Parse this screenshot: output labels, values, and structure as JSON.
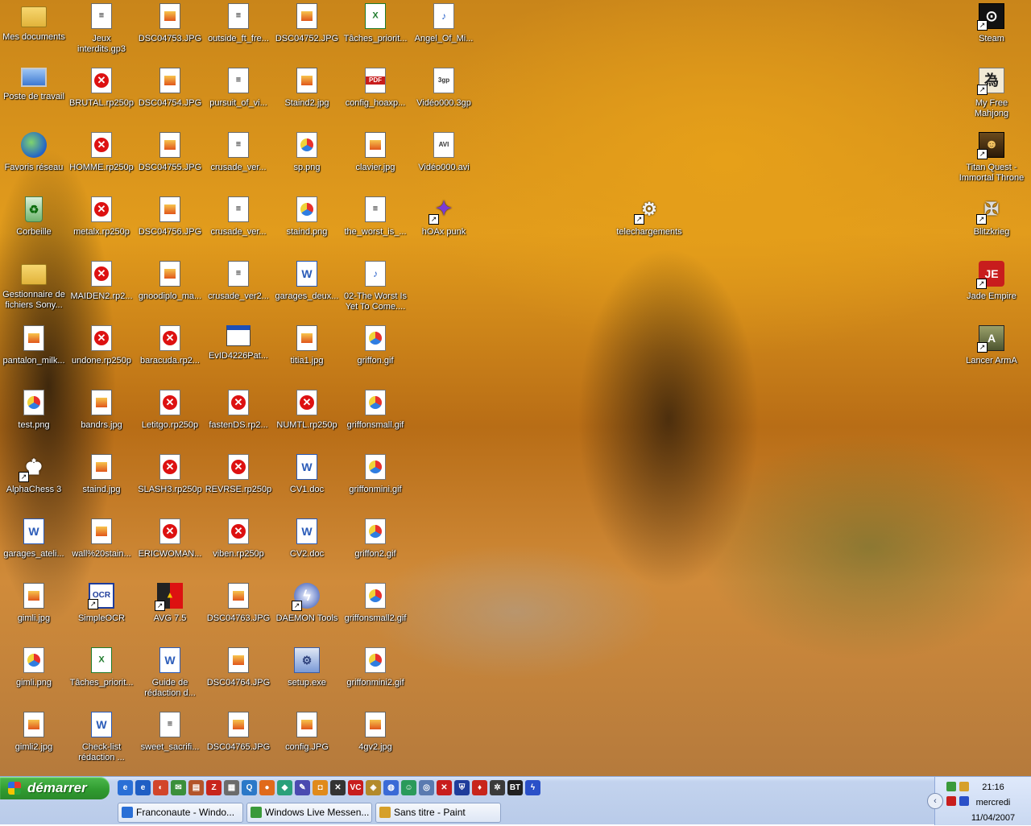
{
  "desktop": {
    "icons": [
      {
        "label": "Mes documents",
        "type": "folder",
        "sym": ""
      },
      {
        "label": "Jeux\ninterdits.gp3",
        "type": "doc",
        "sym": "≡"
      },
      {
        "label": "DSC04753.JPG",
        "type": "jpg",
        "sym": ""
      },
      {
        "label": "outside_ft_fre...",
        "type": "doc",
        "sym": "≡"
      },
      {
        "label": "DSC04752.JPG",
        "type": "jpg",
        "sym": ""
      },
      {
        "label": "Tâches_priorit...",
        "type": "xls",
        "sym": "X"
      },
      {
        "label": "Angel_Of_Mi...",
        "type": "mp3",
        "sym": "♪"
      },
      {
        "label": "Poste de travail",
        "type": "pc",
        "sym": ""
      },
      {
        "label": "BRUTAL.rp250p",
        "type": "rp",
        "sym": "✕"
      },
      {
        "label": "DSC04754.JPG",
        "type": "jpg",
        "sym": ""
      },
      {
        "label": "pursuit_of_vi...",
        "type": "doc",
        "sym": "≡"
      },
      {
        "label": "Staind2.jpg",
        "type": "jpg",
        "sym": ""
      },
      {
        "label": "config_hoaxp...",
        "type": "pdf",
        "sym": "PDF"
      },
      {
        "label": "Vidéo000.3gp",
        "type": "3gp",
        "sym": "3gp"
      },
      {
        "label": "Favoris réseau",
        "type": "net",
        "sym": ""
      },
      {
        "label": "HOMME.rp250p",
        "type": "rp",
        "sym": "✕"
      },
      {
        "label": "DSC04755.JPG",
        "type": "jpg",
        "sym": ""
      },
      {
        "label": "crusade_ver...",
        "type": "doc",
        "sym": "≡"
      },
      {
        "label": "sp.png",
        "type": "png",
        "sym": ""
      },
      {
        "label": "clavier.jpg",
        "type": "jpg",
        "sym": ""
      },
      {
        "label": "Vidéo000.avi",
        "type": "avi",
        "sym": "AVI"
      },
      {
        "label": "Corbeille",
        "type": "bin",
        "sym": "♻"
      },
      {
        "label": "metalx.rp250p",
        "type": "rp",
        "sym": "✕"
      },
      {
        "label": "DSC04756.JPG",
        "type": "jpg",
        "sym": ""
      },
      {
        "label": "crusade_ver...",
        "type": "doc",
        "sym": "≡"
      },
      {
        "label": "staind.png",
        "type": "png",
        "sym": ""
      },
      {
        "label": "the_worst_is_...",
        "type": "doc",
        "sym": "≡"
      },
      {
        "label": "hOAx punk",
        "type": "hoax",
        "sym": "✦"
      },
      {
        "label": "Gestionnaire de\nfichiers Sony...",
        "type": "folder",
        "sym": ""
      },
      {
        "label": "MAIDEN2.rp2...",
        "type": "rp",
        "sym": "✕"
      },
      {
        "label": "gnoodiplo_ma...",
        "type": "jpg",
        "sym": ""
      },
      {
        "label": "crusade_ver2...",
        "type": "doc",
        "sym": "≡"
      },
      {
        "label": "garages_deux...",
        "type": "word",
        "sym": "W"
      },
      {
        "label": "02-The Worst Is\nYet To Come....",
        "type": "mp3",
        "sym": "♪"
      },
      {
        "label": "pantalon_milk...",
        "type": "jpg",
        "sym": ""
      },
      {
        "label": "undone.rp250p",
        "type": "rp",
        "sym": "✕"
      },
      {
        "label": "baracuda.rp2...",
        "type": "rp",
        "sym": "✕"
      },
      {
        "label": "EvID4226Pat...",
        "type": "window",
        "sym": ""
      },
      {
        "label": "titia1.jpg",
        "type": "jpg",
        "sym": ""
      },
      {
        "label": "griffon.gif",
        "type": "gif",
        "sym": ""
      },
      {
        "label": "test.png",
        "type": "png",
        "sym": ""
      },
      {
        "label": "bandrs.jpg",
        "type": "jpg",
        "sym": ""
      },
      {
        "label": "Letitgo.rp250p",
        "type": "rp",
        "sym": "✕"
      },
      {
        "label": "fastenDS.rp2...",
        "type": "rp",
        "sym": "✕"
      },
      {
        "label": "NUMTL.rp250p",
        "type": "rp",
        "sym": "✕"
      },
      {
        "label": "griffonsmall.gif",
        "type": "gif",
        "sym": ""
      },
      {
        "label": "AlphaChess 3",
        "type": "chess",
        "sym": "♚"
      },
      {
        "label": "staind.jpg",
        "type": "jpg",
        "sym": ""
      },
      {
        "label": "SLASH3.rp250p",
        "type": "rp",
        "sym": "✕"
      },
      {
        "label": "REVRSE.rp250p",
        "type": "rp",
        "sym": "✕"
      },
      {
        "label": "CV1.doc",
        "type": "word",
        "sym": "W"
      },
      {
        "label": "griffonmini.gif",
        "type": "gif",
        "sym": ""
      },
      {
        "label": "garages_ateli...",
        "type": "word",
        "sym": "W"
      },
      {
        "label": "wall%20stain...",
        "type": "jpg",
        "sym": ""
      },
      {
        "label": "ERICWOMAN...",
        "type": "rp",
        "sym": "✕"
      },
      {
        "label": "viben.rp250p",
        "type": "rp",
        "sym": "✕"
      },
      {
        "label": "CV2.doc",
        "type": "word",
        "sym": "W"
      },
      {
        "label": "griffon2.gif",
        "type": "gif",
        "sym": ""
      },
      {
        "label": "gimli.jpg",
        "type": "jpg",
        "sym": ""
      },
      {
        "label": "SimpleOCR",
        "type": "ocr",
        "sym": "OCR"
      },
      {
        "label": "AVG 7.5",
        "type": "avg",
        "sym": "▲"
      },
      {
        "label": "DSC04763.JPG",
        "type": "jpg",
        "sym": ""
      },
      {
        "label": "DAEMON Tools",
        "type": "daemon",
        "sym": "ϟ"
      },
      {
        "label": "griffonsmall2.gif",
        "type": "gif",
        "sym": ""
      },
      {
        "label": "gimli.png",
        "type": "png",
        "sym": ""
      },
      {
        "label": "Tâches_priorit...",
        "type": "xls",
        "sym": "X"
      },
      {
        "label": "Guide de\nrédaction d...",
        "type": "word",
        "sym": "W"
      },
      {
        "label": "DSC04764.JPG",
        "type": "jpg",
        "sym": ""
      },
      {
        "label": "setup.exe",
        "type": "setup",
        "sym": "⚙"
      },
      {
        "label": "griffonmini2.gif",
        "type": "gif",
        "sym": ""
      },
      {
        "label": "gimli2.jpg",
        "type": "jpg",
        "sym": ""
      },
      {
        "label": "Check-list\nrédaction ...",
        "type": "word",
        "sym": "W"
      },
      {
        "label": "sweet_sacrifi...",
        "type": "doc",
        "sym": "≡"
      },
      {
        "label": "DSC04765.JPG",
        "type": "jpg",
        "sym": ""
      },
      {
        "label": "config.JPG",
        "type": "jpg",
        "sym": ""
      },
      {
        "label": "4gv2.jpg",
        "type": "jpg",
        "sym": ""
      },
      {
        "label": "telechargements",
        "type": "tele",
        "sym": "⚙"
      },
      {
        "label": "Steam",
        "type": "steam",
        "sym": "⊙"
      },
      {
        "label": "My Free\nMahjong",
        "type": "mahjong",
        "sym": "為"
      },
      {
        "label": "Titan Quest -\nImmortal Throne",
        "type": "titan",
        "sym": "☻"
      },
      {
        "label": "Blitzkrieg",
        "type": "blitz",
        "sym": "✠"
      },
      {
        "label": "Jade Empire",
        "type": "jade",
        "sym": "JE"
      },
      {
        "label": "Lancer ArmA",
        "type": "arma",
        "sym": "A"
      }
    ]
  },
  "taskbar": {
    "start_label": "démarrer",
    "quicklaunch": [
      {
        "name": "ie-icon",
        "sym": "e",
        "color": "#2a6fd6"
      },
      {
        "name": "ie-icon-2",
        "sym": "e",
        "color": "#1f5ec4"
      },
      {
        "name": "media-icon",
        "sym": "◐",
        "color": "#d2452a"
      },
      {
        "name": "mail-icon",
        "sym": "✉",
        "color": "#3a8f3a"
      },
      {
        "name": "archive-icon",
        "sym": "▤",
        "color": "#b3542a"
      },
      {
        "name": "filezilla-icon",
        "sym": "Z",
        "color": "#c8251c"
      },
      {
        "name": "tool-icon",
        "sym": "▦",
        "color": "#6b6b6b"
      },
      {
        "name": "search-icon",
        "sym": "Q",
        "color": "#2b78c8"
      },
      {
        "name": "firefox-icon",
        "sym": "●",
        "color": "#e06a1b"
      },
      {
        "name": "app-icon",
        "sym": "◆",
        "color": "#2aa07a"
      },
      {
        "name": "pen-icon",
        "sym": "✎",
        "color": "#4a4ab0"
      },
      {
        "name": "orange-icon",
        "sym": "◘",
        "color": "#e08a1b"
      },
      {
        "name": "xmark-icon",
        "sym": "✕",
        "color": "#333333"
      },
      {
        "name": "vc-icon",
        "sym": "VC",
        "color": "#c81d1d"
      },
      {
        "name": "tag-icon",
        "sym": "◈",
        "color": "#b38a2a"
      },
      {
        "name": "globe-icon",
        "sym": "◍",
        "color": "#3a6ad6"
      },
      {
        "name": "people-icon",
        "sym": "☺",
        "color": "#2a9a5a"
      },
      {
        "name": "cd-icon",
        "sym": "◎",
        "color": "#5a7ab0"
      },
      {
        "name": "real-icon",
        "sym": "✕",
        "color": "#c81d1d"
      },
      {
        "name": "shield-icon",
        "sym": "⛨",
        "color": "#1f3d9b"
      },
      {
        "name": "game-icon",
        "sym": "♦",
        "color": "#c8251c"
      },
      {
        "name": "bug-icon",
        "sym": "✲",
        "color": "#3a3a3a"
      },
      {
        "name": "bt-icon",
        "sym": "BT",
        "color": "#202020"
      },
      {
        "name": "bolt-icon",
        "sym": "ϟ",
        "color": "#2a50c8"
      }
    ],
    "tasks": [
      {
        "label": "Franconaute - Windo...",
        "color": "#2a6fd6"
      },
      {
        "label": "Windows Live Messen...",
        "color": "#3a9a3a"
      },
      {
        "label": "Sans titre - Paint",
        "color": "#d6a02a"
      }
    ],
    "clock": {
      "time": "21:16",
      "day": "mercredi",
      "date": "11/04/2007"
    }
  }
}
